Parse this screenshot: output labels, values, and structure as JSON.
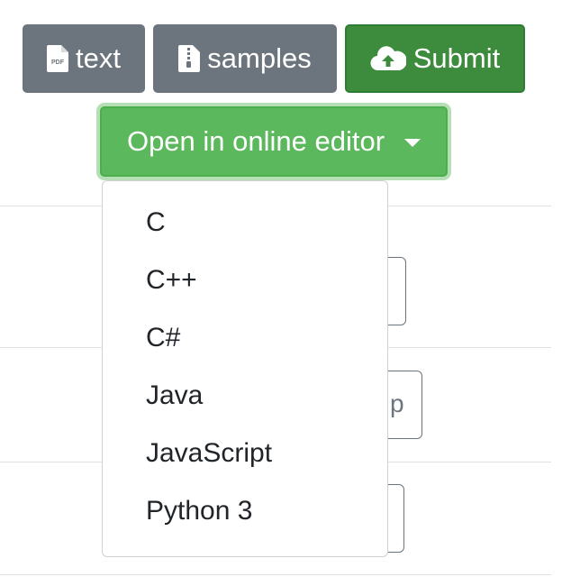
{
  "toolbar": {
    "text_label": "text",
    "samples_label": "samples",
    "submit_label": "Submit",
    "editor_label": "Open in online editor",
    "pdf_icon_text": "PDF"
  },
  "colors": {
    "secondary": "#6c757d",
    "submit": "#3d8b3d",
    "editor": "#5cb85c"
  },
  "icons": {
    "text_button": "file-pdf-icon",
    "samples_button": "file-zip-icon",
    "submit_button": "cloud-upload-icon",
    "editor_button": "caret-down-icon"
  },
  "dropdown": {
    "items": [
      "C",
      "C++",
      "C#",
      "Java",
      "JavaScript",
      "Python 3"
    ]
  },
  "background": {
    "partial_button_text": "p"
  }
}
